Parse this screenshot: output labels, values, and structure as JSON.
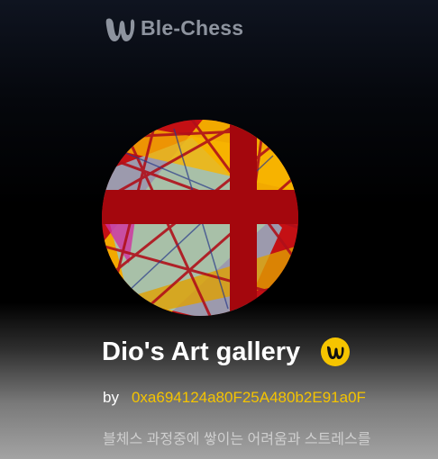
{
  "header": {
    "brand_name": "Ble-Chess",
    "logo_icon": "ble-chess-w-logo-icon"
  },
  "gallery": {
    "avatar_icon": "abstract-painting-avatar",
    "title": "Dio's Art gallery",
    "badge_icon": "ble-chess-badge-icon",
    "by_label": "by",
    "owner_address": "0xa694124a80F25A480b2E91a0F",
    "description": "블체스 과정중에 쌓이는 어려움과 스트레스를"
  },
  "colors": {
    "brand_text": "#8d939e",
    "accent": "#f5c400",
    "title_text": "#ffffff",
    "avatar_base": "#ad0a0e"
  }
}
